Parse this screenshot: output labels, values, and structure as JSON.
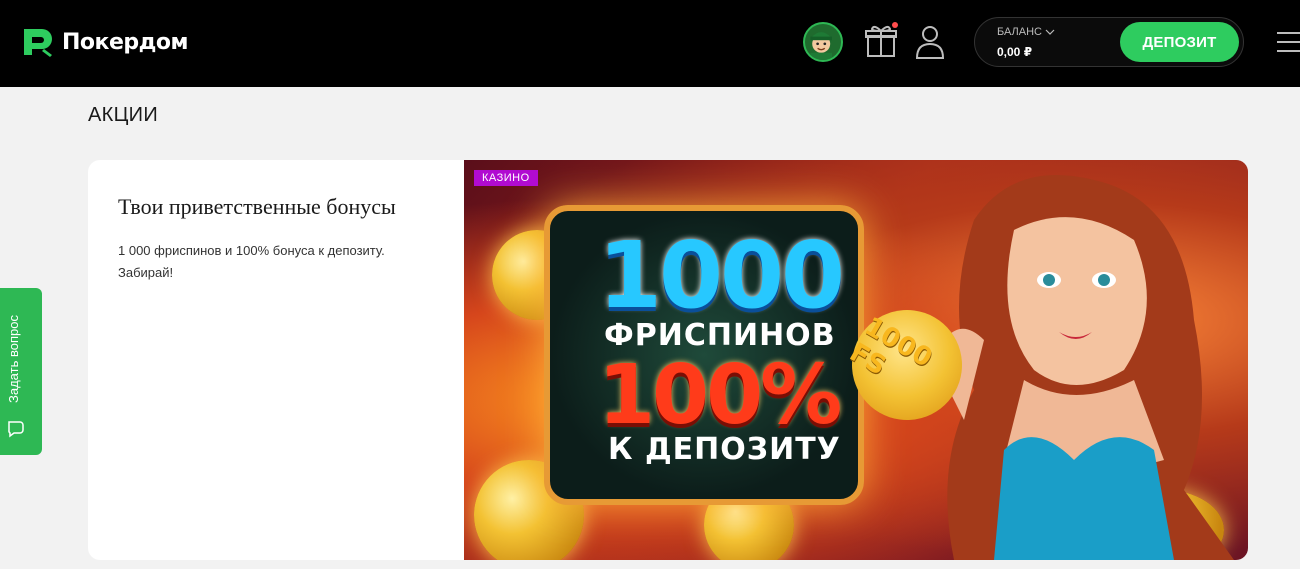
{
  "header": {
    "brand": "Покердом",
    "balance_label": "БАЛАНС",
    "balance_value": "0,00 ₽",
    "deposit_label": "ДЕПОЗИТ"
  },
  "page": {
    "title": "АКЦИИ"
  },
  "promo": {
    "title": "Твои приветственные бонусы",
    "description": "1 000 фриспинов и 100% бонуса к депозиту. Забирай!",
    "badge": "КАЗИНО",
    "banner": {
      "headline_number": "1000",
      "headline_line1": "ФРИСПИНОВ",
      "headline_percent": "100%",
      "headline_line2": "К ДЕПОЗИТУ",
      "coin_text": "1000 FS"
    }
  },
  "side_tab": {
    "label": "Задать вопрос"
  },
  "icons": {
    "logo": "pokerdom-logo-icon",
    "avatar": "avatar-icon",
    "gift": "gift-icon",
    "user": "user-icon",
    "chevron": "chevron-down-icon",
    "menu": "menu-icon",
    "chat": "chat-icon"
  },
  "colors": {
    "accent": "#2ecc5f",
    "header_bg": "#000000",
    "badge": "#b10bd1",
    "notification": "#ff4d4d"
  }
}
